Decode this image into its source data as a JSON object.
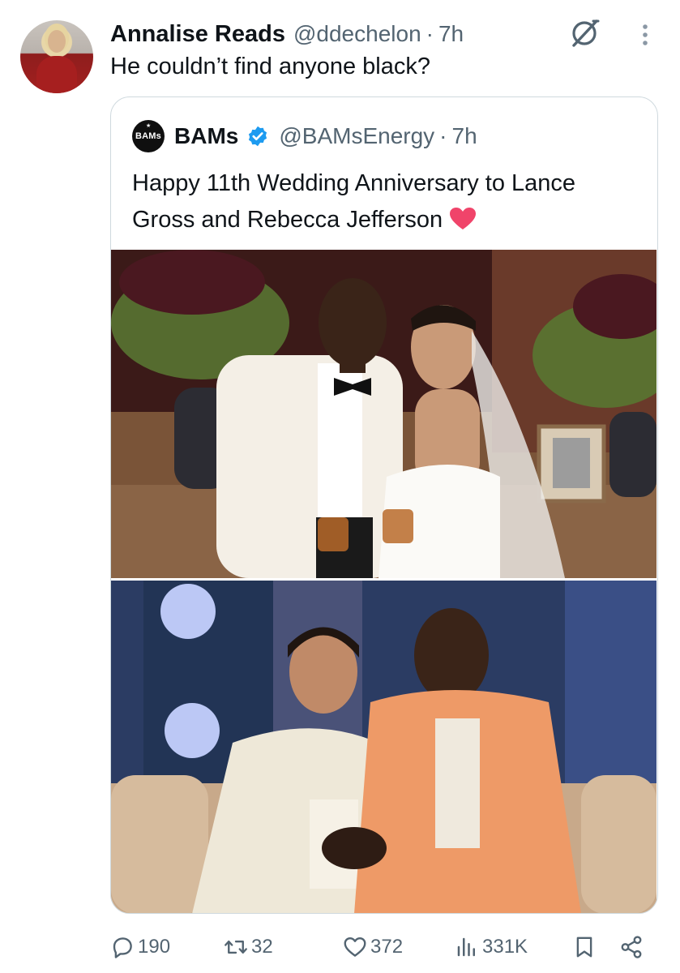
{
  "tweet": {
    "author_name": "Annalise Reads",
    "author_handle": "@ddechelon",
    "separator": "·",
    "time": "7h",
    "text": "He couldn’t find anyone black?"
  },
  "quoted": {
    "avatar_text": "BAMs",
    "author_name": "BAMs",
    "author_handle": "@BAMsEnergy",
    "separator": "·",
    "time": "7h",
    "text": "Happy 11th Wedding Anniversary to Lance Gross and Rebecca Jefferson",
    "emoji": "red-heart-emoji",
    "images": [
      {
        "name": "wedding-photo"
      },
      {
        "name": "couple-event-photo"
      }
    ]
  },
  "actions": {
    "replies": "190",
    "reposts": "32",
    "likes": "372",
    "views": "331K"
  },
  "colors": {
    "text": "#0f1419",
    "secondary": "#536471",
    "border": "#cfd9de",
    "verified": "#1d9bf0",
    "heart": "#f0446a"
  },
  "icons": [
    "grok-icon",
    "more-icon",
    "verified-badge-icon",
    "reply-icon",
    "repost-icon",
    "like-icon",
    "views-icon",
    "bookmark-icon",
    "share-icon"
  ]
}
